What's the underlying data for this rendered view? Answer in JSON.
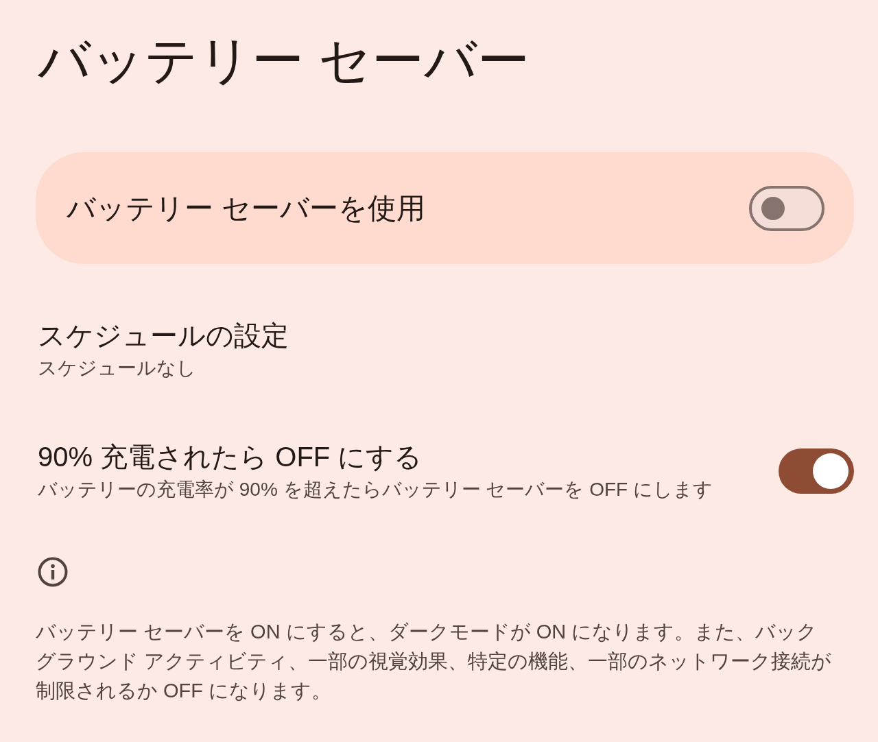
{
  "title": "バッテリー セーバー",
  "main_switch": {
    "label": "バッテリー セーバーを使用",
    "on": false
  },
  "settings": [
    {
      "kind": "link",
      "title": "スケジュールの設定",
      "summary": "スケジュールなし"
    },
    {
      "kind": "switch",
      "title": "90% 充電されたら OFF にする",
      "summary": "バッテリーの充電率が 90% を超えたらバッテリー セーバーを OFF にします",
      "on": true
    }
  ],
  "footer": {
    "text": "バッテリー セーバーを ON にすると、ダークモードが ON になります。また、バックグラウンド アクティビティ、一部の視覚効果、特定の機能、一部のネットワーク接続が制限されるか OFF になります。"
  }
}
